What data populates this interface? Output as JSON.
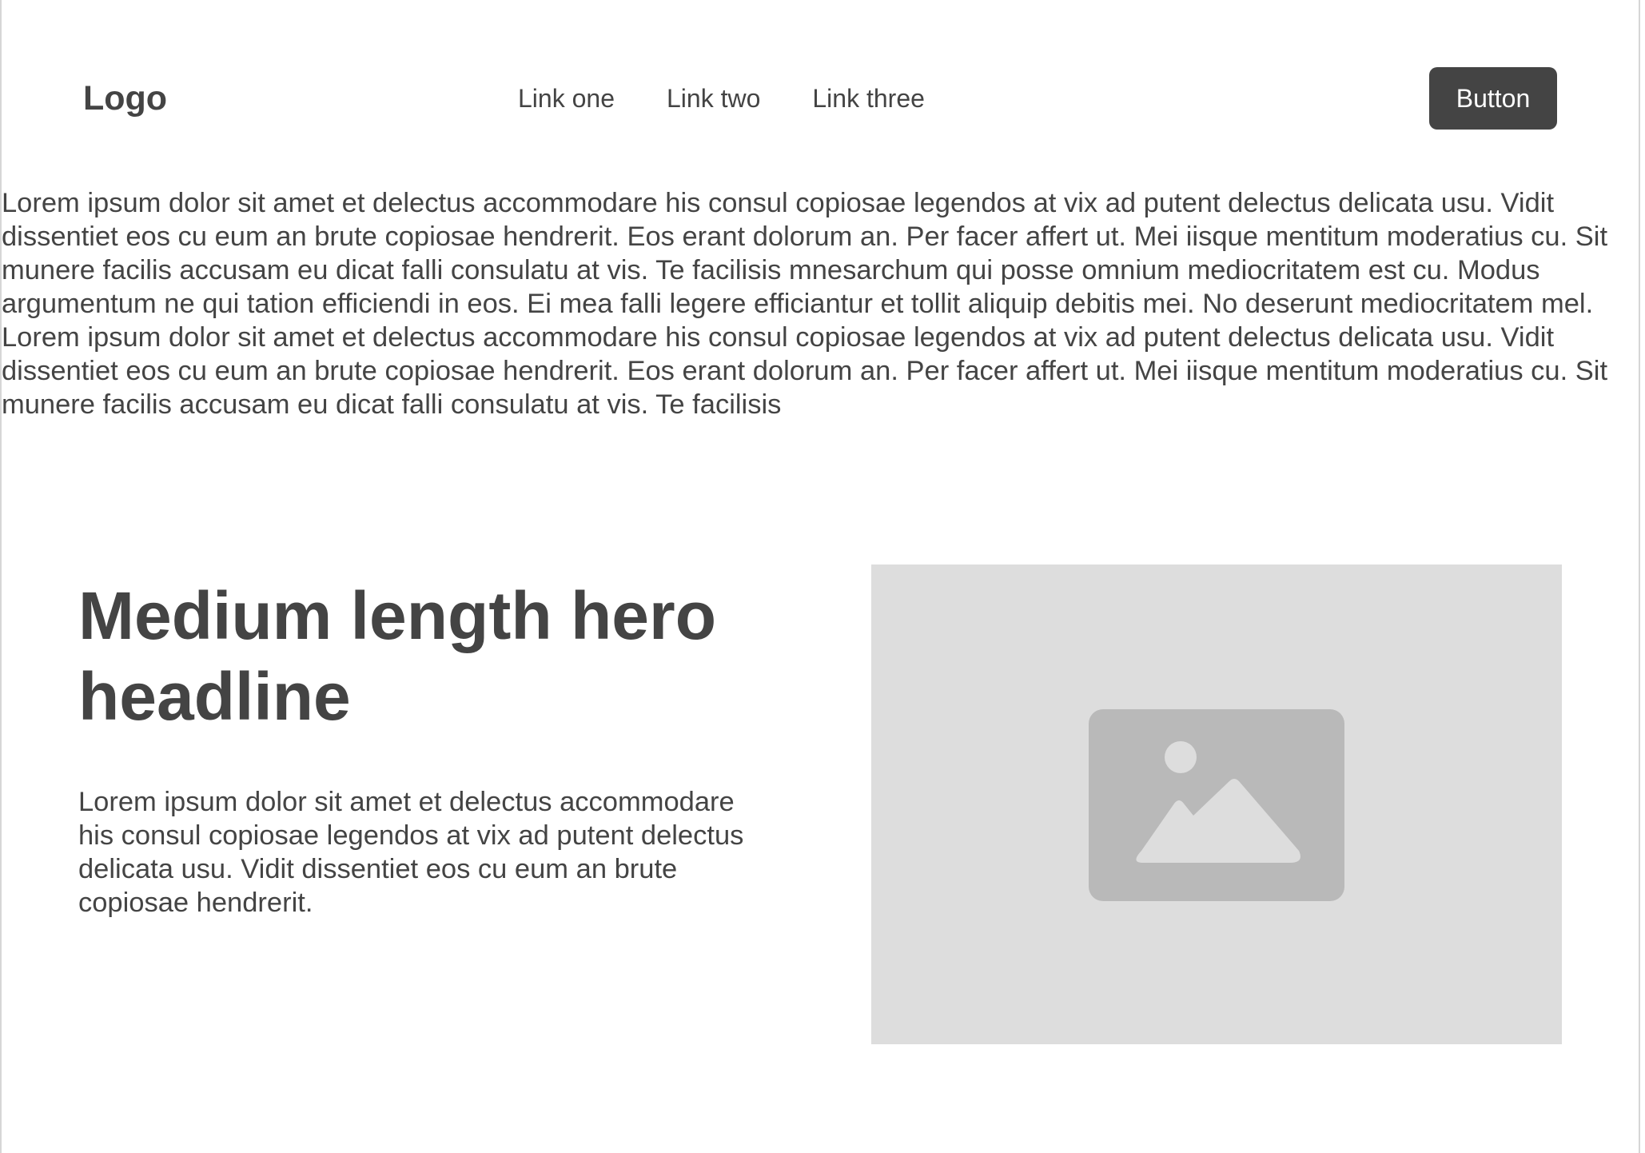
{
  "navbar": {
    "logo": "Logo",
    "links": [
      "Link one",
      "Link two",
      "Link three"
    ],
    "button_label": "Button"
  },
  "intro": {
    "text": "Lorem ipsum dolor sit amet et delectus accommodare his consul copiosae legendos at vix ad putent delectus delicata usu. Vidit dissentiet eos cu eum an brute copiosae hendrerit. Eos erant dolorum an. Per facer affert ut. Mei iisque mentitum moderatius cu. Sit munere facilis accusam eu dicat falli consulatu at vis. Te facilisis mnesarchum qui posse omnium mediocritatem est cu. Modus argumentum ne qui tation efficiendi in eos. Ei mea falli legere efficiantur et tollit aliquip debitis mei. No deserunt mediocritatem mel. Lorem ipsum dolor sit amet et delectus accommodare his consul copiosae legendos at vix ad putent delectus delicata usu. Vidit dissentiet eos cu eum an brute copiosae hendrerit. Eos erant dolorum an. Per facer affert ut. Mei iisque mentitum moderatius cu. Sit munere facilis accusam eu dicat falli consulatu at vis. Te facilisis"
  },
  "hero": {
    "headline": "Medium length hero headline",
    "body": "Lorem ipsum dolor sit amet et delectus accommodare his consul copiosae legendos at vix ad putent delectus delicata usu. Vidit dissentiet eos cu eum an brute copiosae hendrerit.",
    "image_icon": "image-placeholder-icon"
  },
  "colors": {
    "text": "#444444",
    "button_bg": "#444444",
    "button_text": "#ffffff",
    "image_bg": "#dddddd",
    "icon": "#b9b9b9"
  }
}
